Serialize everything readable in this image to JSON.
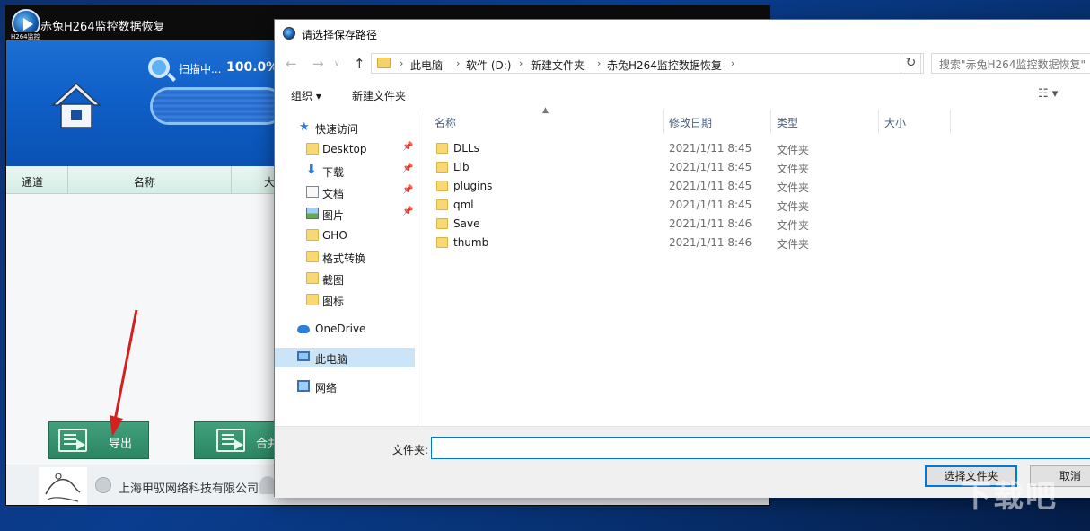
{
  "app": {
    "title": "赤兔H264监控数据恢复",
    "logo_caption": "H264监控",
    "scan_label": "扫描中...",
    "scan_percent": "100.0%",
    "scan_progress": 1.0,
    "columns": [
      "通道",
      "名称",
      "大"
    ],
    "buttons": {
      "export": "导出",
      "merge": "合并"
    },
    "footer": {
      "company": "上海甲驭网络科技有限公司"
    }
  },
  "dialog": {
    "title": "请选择保存路径",
    "breadcrumbs": [
      "此电脑",
      "软件 (D:)",
      "新建文件夹",
      "赤兔H264监控数据恢复"
    ],
    "search_placeholder": "搜索\"赤兔H264监控数据恢复\"",
    "toolbar": {
      "organize": "组织 ▾",
      "new_folder": "新建文件夹"
    },
    "nav": [
      {
        "label": "快速访问",
        "icon": "star-icon"
      },
      {
        "label": "Desktop",
        "icon": "folder-icon",
        "pinned": true
      },
      {
        "label": "下载",
        "icon": "download-icon",
        "pinned": true
      },
      {
        "label": "文档",
        "icon": "document-icon",
        "pinned": true
      },
      {
        "label": "图片",
        "icon": "picture-icon",
        "pinned": true
      },
      {
        "label": "GHO",
        "icon": "folder-icon"
      },
      {
        "label": "格式转换",
        "icon": "folder-icon"
      },
      {
        "label": "截图",
        "icon": "folder-icon"
      },
      {
        "label": "图标",
        "icon": "folder-icon"
      },
      {
        "label": "OneDrive",
        "icon": "cloud-icon"
      },
      {
        "label": "此电脑",
        "icon": "computer-icon",
        "selected": true
      },
      {
        "label": "网络",
        "icon": "network-icon"
      }
    ],
    "columns": [
      "名称",
      "修改日期",
      "类型",
      "大小"
    ],
    "files": [
      {
        "name": "DLLs",
        "date": "2021/1/11 8:45",
        "type": "文件夹"
      },
      {
        "name": "Lib",
        "date": "2021/1/11 8:45",
        "type": "文件夹"
      },
      {
        "name": "plugins",
        "date": "2021/1/11 8:45",
        "type": "文件夹"
      },
      {
        "name": "qml",
        "date": "2021/1/11 8:45",
        "type": "文件夹"
      },
      {
        "name": "Save",
        "date": "2021/1/11 8:46",
        "type": "文件夹"
      },
      {
        "name": "thumb",
        "date": "2021/1/11 8:46",
        "type": "文件夹"
      }
    ],
    "folder_label": "文件夹:",
    "folder_value": "",
    "select_button": "选择文件夹",
    "cancel_button": "取消"
  },
  "colors": {
    "accent": "#0078d7",
    "app_blue": "#0f5fc8",
    "app_green": "#2b8663",
    "annotation_red": "#d42020"
  }
}
